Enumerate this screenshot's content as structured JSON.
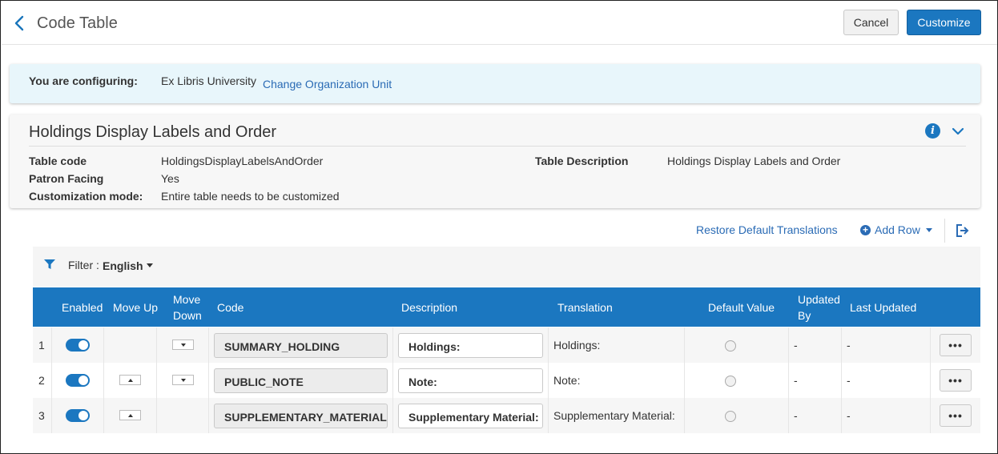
{
  "header": {
    "title": "Code Table",
    "cancel_label": "Cancel",
    "customize_label": "Customize"
  },
  "configuring": {
    "label": "You are configuring:",
    "org": "Ex Libris University",
    "change_link": "Change Organization Unit"
  },
  "details": {
    "title": "Holdings Display Labels and Order",
    "table_code_label": "Table code",
    "table_code_value": "HoldingsDisplayLabelsAndOrder",
    "patron_facing_label": "Patron Facing",
    "patron_facing_value": "Yes",
    "customization_mode_label": "Customization mode:",
    "customization_mode_value": "Entire table needs to be customized",
    "table_description_label": "Table Description",
    "table_description_value": "Holdings Display Labels and Order"
  },
  "toolbar": {
    "restore_label": "Restore Default Translations",
    "add_row_label": "Add Row"
  },
  "filter": {
    "label": "Filter :",
    "value": "English"
  },
  "table": {
    "columns": {
      "enabled": "Enabled",
      "move_up": "Move Up",
      "move_down_1": "Move",
      "move_down_2": "Down",
      "code": "Code",
      "description": "Description",
      "translation": "Translation",
      "default_value": "Default Value",
      "updated_by_1": "Updated",
      "updated_by_2": "By",
      "last_updated": "Last Updated"
    },
    "rows": [
      {
        "num": "1",
        "enabled": true,
        "code": "SUMMARY_HOLDING",
        "description": "Holdings:",
        "translation": "Holdings:",
        "updated_by": "-",
        "last_updated": "-",
        "more": "•••"
      },
      {
        "num": "2",
        "enabled": true,
        "code": "PUBLIC_NOTE",
        "description": "Note:",
        "translation": "Note:",
        "updated_by": "-",
        "last_updated": "-",
        "more": "•••"
      },
      {
        "num": "3",
        "enabled": true,
        "code": "SUPPLEMENTARY_MATERIAL",
        "description": "Supplementary Material:",
        "translation": "Supplementary Material:",
        "updated_by": "-",
        "last_updated": "-",
        "more": "•••"
      }
    ]
  },
  "colors": {
    "primary": "#1b77c0",
    "link": "#2a6bb5",
    "config_bg": "#e8f6fb"
  }
}
